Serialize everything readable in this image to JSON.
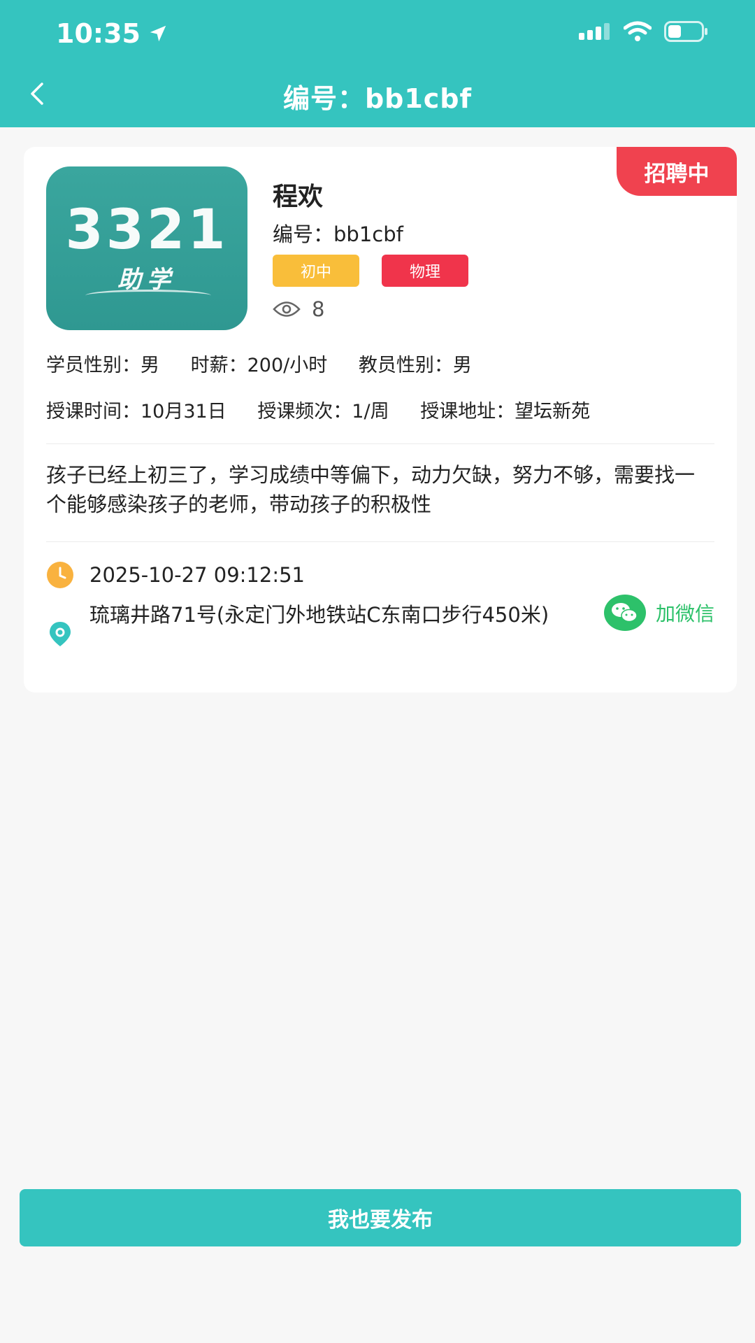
{
  "status_bar": {
    "time": "10:35"
  },
  "nav": {
    "title": "编号：bb1cbf"
  },
  "card": {
    "badge": "招聘中",
    "logo": {
      "number": "3321",
      "subtitle": "助学"
    },
    "name": "程欢",
    "code": "编号：bb1cbf",
    "tags": {
      "grade": "初中",
      "subject": "物理"
    },
    "views": "8",
    "info_row1": {
      "student_gender": "学员性别：男",
      "hourly_pay": "时薪：200/小时",
      "teacher_gender": "教员性别：男"
    },
    "info_row2": {
      "lesson_time": "授课时间：10月31日",
      "frequency": "授课频次：1/周",
      "address": "授课地址：望坛新苑"
    },
    "description": "孩子已经上初三了，学习成绩中等偏下，动力欠缺，努力不够，需要找一个能够感染孩子的老师，带动孩子的积极性",
    "datetime": "2025-10-27 09:12:51",
    "location": "琉璃井路71号(永定门外地铁站C东南口步行450米)",
    "wechat_label": "加微信"
  },
  "publish_button": "我也要发布",
  "colors": {
    "primary": "#35c4bf",
    "badge_red": "#f0424f",
    "grade_yellow": "#f9be3a",
    "subject_red": "#f0344b",
    "wechat_green": "#2dc16a",
    "clock_orange": "#f9b23f"
  }
}
